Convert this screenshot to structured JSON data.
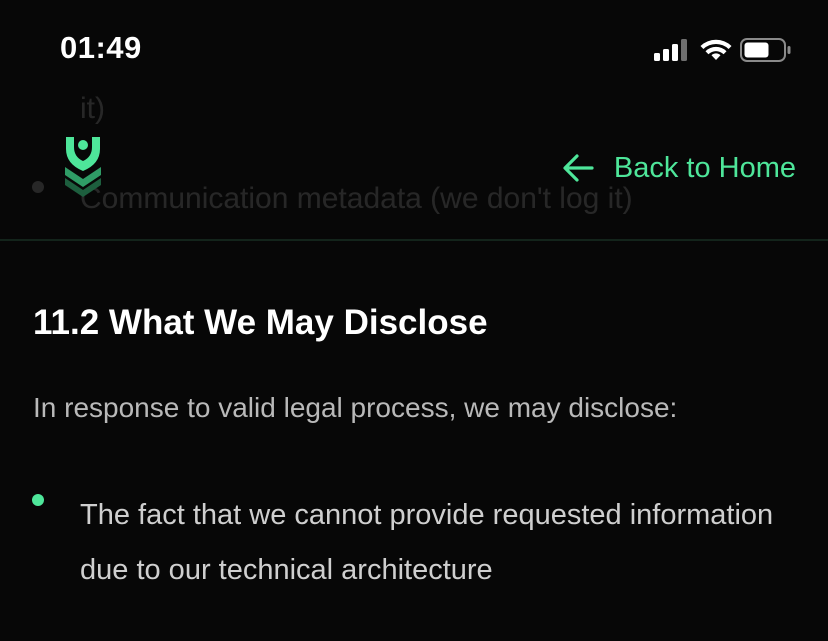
{
  "status_bar": {
    "time": "01:49",
    "icons": [
      "signal-icon",
      "wifi-icon",
      "battery-icon"
    ]
  },
  "background_text": {
    "line_1": "it)",
    "line_2": "Communication metadata (we don't log it)"
  },
  "header": {
    "logo_icon": "shield-chevron-logo",
    "back_label": "Back to Home",
    "back_icon": "arrow-left-icon"
  },
  "main": {
    "section_title": "11.2 What We May Disclose",
    "intro": "In response to valid legal process, we may disclose:",
    "bullets": [
      "The fact that we cannot provide requested information due to our technical architecture"
    ]
  },
  "colors": {
    "accent": "#4ee69a",
    "background": "#070707",
    "divider": "#13241b",
    "body_text": "#cfcfcf"
  }
}
